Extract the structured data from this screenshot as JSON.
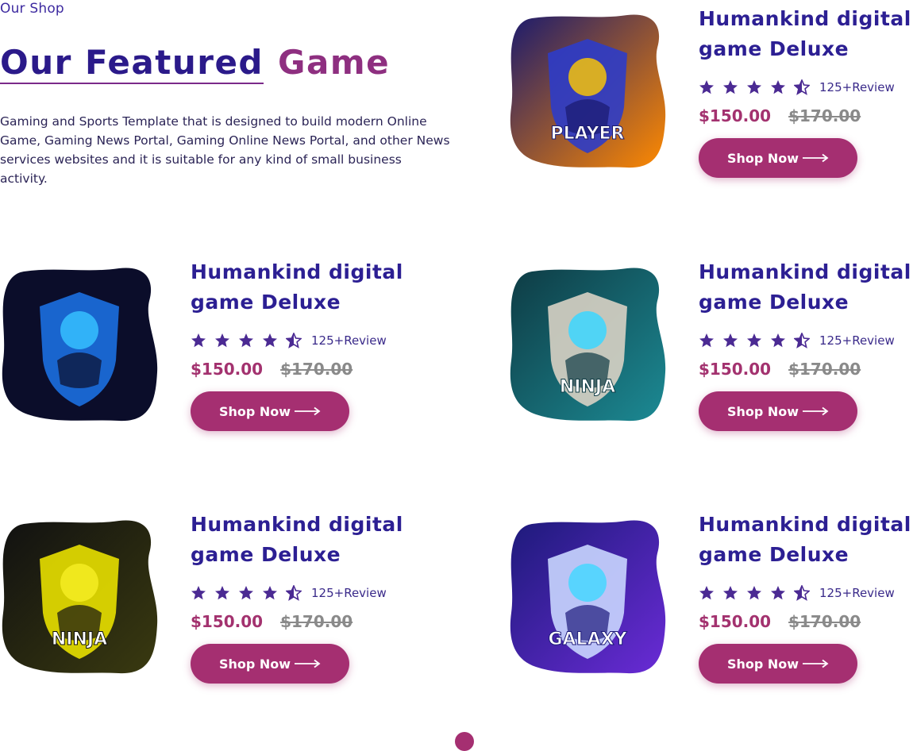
{
  "header": {
    "eyebrow": "Our Shop",
    "title_part1": "Our Featured",
    "title_part2": "Game",
    "description": "Gaming and Sports Template that is designed to build modern Online Game, Gaming News Portal, Gaming Online News Portal, and other News services websites and it is suitable for any kind of small business activity."
  },
  "colors": {
    "primary": "#2c1f93",
    "accent": "#a52f71",
    "star": "#4b2a93"
  },
  "products": [
    {
      "title": "Humankind digital game Deluxe",
      "rating": 4.5,
      "review": "125+Review",
      "price": "$150.00",
      "old_price": "$170.00",
      "button": "Shop Now",
      "image": "pro-player-logo"
    },
    {
      "title": "Humankind digital game Deluxe",
      "rating": 4.5,
      "review": "125+Review",
      "price": "$150.00",
      "old_price": "$170.00",
      "button": "Shop Now",
      "image": "hooded-assassin-logo"
    },
    {
      "title": "Humankind digital game Deluxe",
      "rating": 4.5,
      "review": "125+Review",
      "price": "$150.00",
      "old_price": "$170.00",
      "button": "Shop Now",
      "image": "ninja-warrior-logo"
    },
    {
      "title": "Humankind digital game Deluxe",
      "rating": 4.5,
      "review": "125+Review",
      "price": "$150.00",
      "old_price": "$170.00",
      "button": "Shop Now",
      "image": "ninja-yellow-logo"
    },
    {
      "title": "Humankind digital game Deluxe",
      "rating": 4.5,
      "review": "125+Review",
      "price": "$150.00",
      "old_price": "$170.00",
      "button": "Shop Now",
      "image": "galaxy-astronaut-logo"
    }
  ],
  "pagination": {
    "active_page": 1
  }
}
